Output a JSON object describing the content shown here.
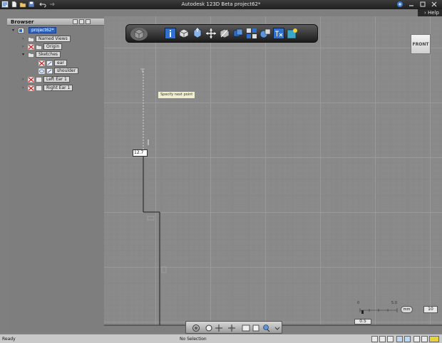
{
  "app": {
    "title": "Autodesk 123D Beta   project62*"
  },
  "help": {
    "label": "Help"
  },
  "quick_access": [
    "app-menu-icon",
    "new-icon",
    "open-icon",
    "save-icon",
    "undo-icon",
    "redo-icon"
  ],
  "browser": {
    "title": "Browser",
    "root": "project62*",
    "items": [
      {
        "label": "Named Views"
      },
      {
        "label": "Origin"
      },
      {
        "label": "Sketches"
      },
      {
        "label": "ear"
      },
      {
        "label": "shoulder"
      },
      {
        "label": "Left Ear 1"
      },
      {
        "label": "Right Ear 1"
      }
    ]
  },
  "toolbar": {
    "buttons": [
      "info-icon",
      "primitives-icon",
      "extrude-icon",
      "transform-icon",
      "modify-icon",
      "pattern-icon",
      "grid-icon",
      "combine-icon",
      "text-icon",
      "materials-icon"
    ]
  },
  "viewcube": {
    "label": "FRONT"
  },
  "tooltip": {
    "text": "Specify next point"
  },
  "dimension": {
    "value": "12.7"
  },
  "scale": {
    "zero": "0",
    "mid": "5.0",
    "unit": "mm",
    "zoom": "10",
    "value": "0.5"
  },
  "status": {
    "left": "Ready",
    "center": "No Selection"
  },
  "colors": {
    "selection": "#2a64c8",
    "sketch_line": "#1a1a1a",
    "tooltip_bg": "#f1efcf"
  }
}
